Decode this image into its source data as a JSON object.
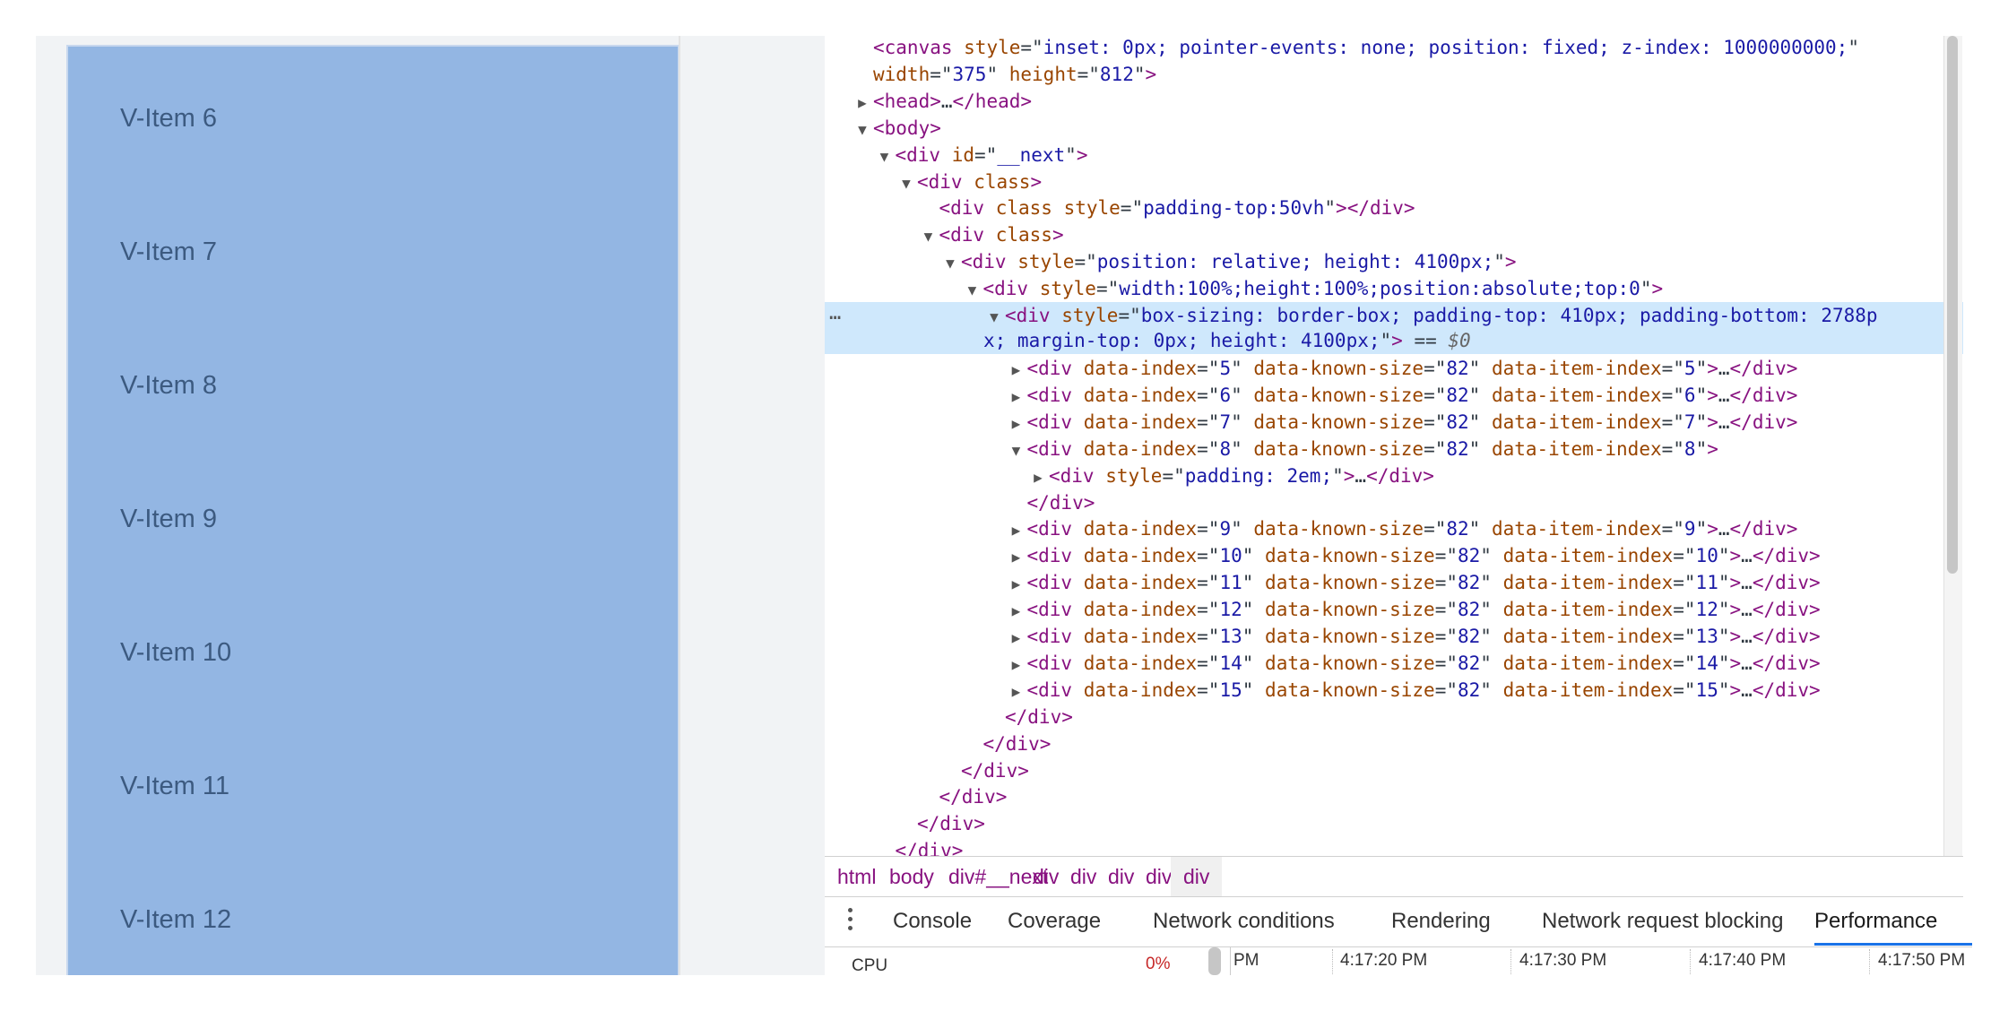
{
  "viewport": {
    "items": [
      "V-Item 6",
      "V-Item 7",
      "V-Item 8",
      "V-Item 9",
      "V-Item 10",
      "V-Item 11",
      "V-Item 12"
    ]
  },
  "elements": {
    "lines": [
      {
        "i": 0,
        "arrow": "",
        "parts": [
          [
            "tag",
            "<canvas "
          ],
          [
            "attr",
            "style"
          ],
          [
            "eq",
            "=\""
          ],
          [
            "val",
            "inset: 0px; pointer-events: none; position: fixed; z-index: 1000000000;"
          ],
          [
            "eq",
            "\""
          ]
        ]
      },
      {
        "i": 0,
        "arrow": "",
        "parts": [
          [
            "attr",
            "width"
          ],
          [
            "eq",
            "=\""
          ],
          [
            "val",
            "375"
          ],
          [
            "eq",
            "\" "
          ],
          [
            "attr",
            "height"
          ],
          [
            "eq",
            "=\""
          ],
          [
            "val",
            "812"
          ],
          [
            "eq",
            "\""
          ],
          [
            "tag",
            ">"
          ]
        ]
      },
      {
        "i": 0,
        "arrow": "▶",
        "parts": [
          [
            "tag",
            "<head>"
          ],
          [
            "txt",
            "…"
          ],
          [
            "tag",
            "</head>"
          ]
        ]
      },
      {
        "i": 0,
        "arrow": "▼",
        "parts": [
          [
            "tag",
            "<body>"
          ]
        ]
      },
      {
        "i": 1,
        "arrow": "▼",
        "parts": [
          [
            "tag",
            "<div "
          ],
          [
            "attr",
            "id"
          ],
          [
            "eq",
            "=\""
          ],
          [
            "val",
            "__next"
          ],
          [
            "eq",
            "\""
          ],
          [
            "tag",
            ">"
          ]
        ]
      },
      {
        "i": 2,
        "arrow": "▼",
        "parts": [
          [
            "tag",
            "<div "
          ],
          [
            "attr",
            "class"
          ],
          [
            "tag",
            ">"
          ]
        ]
      },
      {
        "i": 3,
        "arrow": "",
        "parts": [
          [
            "tag",
            "<div "
          ],
          [
            "attr",
            "class style"
          ],
          [
            "eq",
            "=\""
          ],
          [
            "val",
            "padding-top:50vh"
          ],
          [
            "eq",
            "\""
          ],
          [
            "tag",
            "></div>"
          ]
        ]
      },
      {
        "i": 3,
        "arrow": "▼",
        "parts": [
          [
            "tag",
            "<div "
          ],
          [
            "attr",
            "class"
          ],
          [
            "tag",
            ">"
          ]
        ]
      },
      {
        "i": 4,
        "arrow": "▼",
        "parts": [
          [
            "tag",
            "<div "
          ],
          [
            "attr",
            "style"
          ],
          [
            "eq",
            "=\""
          ],
          [
            "val",
            "position: relative; height: 4100px;"
          ],
          [
            "eq",
            "\""
          ],
          [
            "tag",
            ">"
          ]
        ]
      },
      {
        "i": 5,
        "arrow": "▼",
        "parts": [
          [
            "tag",
            "<div "
          ],
          [
            "attr",
            "style"
          ],
          [
            "eq",
            "=\""
          ],
          [
            "val",
            "width:100%;height:100%;position:absolute;top:0"
          ],
          [
            "eq",
            "\""
          ],
          [
            "tag",
            ">"
          ]
        ]
      },
      {
        "i": 6,
        "arrow": "▼",
        "selected": true,
        "parts": [
          [
            "tag",
            "<div "
          ],
          [
            "attr",
            "style"
          ],
          [
            "eq",
            "=\""
          ],
          [
            "val",
            "box-sizing: border-box; padding-top: 410px; padding-bottom: 2788p"
          ]
        ],
        "cont": [
          [
            "val",
            "x; margin-top: 0px; height: 4100px;"
          ],
          [
            "eq",
            "\""
          ],
          [
            "tag",
            ">"
          ],
          [
            "txt",
            " == "
          ],
          [
            "dollar",
            "$0"
          ]
        ]
      },
      {
        "i": 7,
        "arrow": "▶",
        "parts": [
          [
            "tag",
            "<div "
          ],
          [
            "attr",
            "data-index"
          ],
          [
            "eq",
            "=\""
          ],
          [
            "val",
            "5"
          ],
          [
            "eq",
            "\" "
          ],
          [
            "attr",
            "data-known-size"
          ],
          [
            "eq",
            "=\""
          ],
          [
            "val",
            "82"
          ],
          [
            "eq",
            "\" "
          ],
          [
            "attr",
            "data-item-index"
          ],
          [
            "eq",
            "=\""
          ],
          [
            "val",
            "5"
          ],
          [
            "eq",
            "\""
          ],
          [
            "tag",
            ">"
          ],
          [
            "txt",
            "…"
          ],
          [
            "tag",
            "</div>"
          ]
        ]
      },
      {
        "i": 7,
        "arrow": "▶",
        "parts": [
          [
            "tag",
            "<div "
          ],
          [
            "attr",
            "data-index"
          ],
          [
            "eq",
            "=\""
          ],
          [
            "val",
            "6"
          ],
          [
            "eq",
            "\" "
          ],
          [
            "attr",
            "data-known-size"
          ],
          [
            "eq",
            "=\""
          ],
          [
            "val",
            "82"
          ],
          [
            "eq",
            "\" "
          ],
          [
            "attr",
            "data-item-index"
          ],
          [
            "eq",
            "=\""
          ],
          [
            "val",
            "6"
          ],
          [
            "eq",
            "\""
          ],
          [
            "tag",
            ">"
          ],
          [
            "txt",
            "…"
          ],
          [
            "tag",
            "</div>"
          ]
        ]
      },
      {
        "i": 7,
        "arrow": "▶",
        "parts": [
          [
            "tag",
            "<div "
          ],
          [
            "attr",
            "data-index"
          ],
          [
            "eq",
            "=\""
          ],
          [
            "val",
            "7"
          ],
          [
            "eq",
            "\" "
          ],
          [
            "attr",
            "data-known-size"
          ],
          [
            "eq",
            "=\""
          ],
          [
            "val",
            "82"
          ],
          [
            "eq",
            "\" "
          ],
          [
            "attr",
            "data-item-index"
          ],
          [
            "eq",
            "=\""
          ],
          [
            "val",
            "7"
          ],
          [
            "eq",
            "\""
          ],
          [
            "tag",
            ">"
          ],
          [
            "txt",
            "…"
          ],
          [
            "tag",
            "</div>"
          ]
        ]
      },
      {
        "i": 7,
        "arrow": "▼",
        "parts": [
          [
            "tag",
            "<div "
          ],
          [
            "attr",
            "data-index"
          ],
          [
            "eq",
            "=\""
          ],
          [
            "val",
            "8"
          ],
          [
            "eq",
            "\" "
          ],
          [
            "attr",
            "data-known-size"
          ],
          [
            "eq",
            "=\""
          ],
          [
            "val",
            "82"
          ],
          [
            "eq",
            "\" "
          ],
          [
            "attr",
            "data-item-index"
          ],
          [
            "eq",
            "=\""
          ],
          [
            "val",
            "8"
          ],
          [
            "eq",
            "\""
          ],
          [
            "tag",
            ">"
          ]
        ]
      },
      {
        "i": 8,
        "arrow": "▶",
        "parts": [
          [
            "tag",
            "<div "
          ],
          [
            "attr",
            "style"
          ],
          [
            "eq",
            "=\""
          ],
          [
            "val",
            "padding: 2em;"
          ],
          [
            "eq",
            "\""
          ],
          [
            "tag",
            ">"
          ],
          [
            "txt",
            "…"
          ],
          [
            "tag",
            "</div>"
          ]
        ]
      },
      {
        "i": 7,
        "arrow": "",
        "parts": [
          [
            "tag",
            "</div>"
          ]
        ]
      },
      {
        "i": 7,
        "arrow": "▶",
        "parts": [
          [
            "tag",
            "<div "
          ],
          [
            "attr",
            "data-index"
          ],
          [
            "eq",
            "=\""
          ],
          [
            "val",
            "9"
          ],
          [
            "eq",
            "\" "
          ],
          [
            "attr",
            "data-known-size"
          ],
          [
            "eq",
            "=\""
          ],
          [
            "val",
            "82"
          ],
          [
            "eq",
            "\" "
          ],
          [
            "attr",
            "data-item-index"
          ],
          [
            "eq",
            "=\""
          ],
          [
            "val",
            "9"
          ],
          [
            "eq",
            "\""
          ],
          [
            "tag",
            ">"
          ],
          [
            "txt",
            "…"
          ],
          [
            "tag",
            "</div>"
          ]
        ]
      },
      {
        "i": 7,
        "arrow": "▶",
        "parts": [
          [
            "tag",
            "<div "
          ],
          [
            "attr",
            "data-index"
          ],
          [
            "eq",
            "=\""
          ],
          [
            "val",
            "10"
          ],
          [
            "eq",
            "\" "
          ],
          [
            "attr",
            "data-known-size"
          ],
          [
            "eq",
            "=\""
          ],
          [
            "val",
            "82"
          ],
          [
            "eq",
            "\" "
          ],
          [
            "attr",
            "data-item-index"
          ],
          [
            "eq",
            "=\""
          ],
          [
            "val",
            "10"
          ],
          [
            "eq",
            "\""
          ],
          [
            "tag",
            ">"
          ],
          [
            "txt",
            "…"
          ],
          [
            "tag",
            "</div>"
          ]
        ]
      },
      {
        "i": 7,
        "arrow": "▶",
        "parts": [
          [
            "tag",
            "<div "
          ],
          [
            "attr",
            "data-index"
          ],
          [
            "eq",
            "=\""
          ],
          [
            "val",
            "11"
          ],
          [
            "eq",
            "\" "
          ],
          [
            "attr",
            "data-known-size"
          ],
          [
            "eq",
            "=\""
          ],
          [
            "val",
            "82"
          ],
          [
            "eq",
            "\" "
          ],
          [
            "attr",
            "data-item-index"
          ],
          [
            "eq",
            "=\""
          ],
          [
            "val",
            "11"
          ],
          [
            "eq",
            "\""
          ],
          [
            "tag",
            ">"
          ],
          [
            "txt",
            "…"
          ],
          [
            "tag",
            "</div>"
          ]
        ]
      },
      {
        "i": 7,
        "arrow": "▶",
        "parts": [
          [
            "tag",
            "<div "
          ],
          [
            "attr",
            "data-index"
          ],
          [
            "eq",
            "=\""
          ],
          [
            "val",
            "12"
          ],
          [
            "eq",
            "\" "
          ],
          [
            "attr",
            "data-known-size"
          ],
          [
            "eq",
            "=\""
          ],
          [
            "val",
            "82"
          ],
          [
            "eq",
            "\" "
          ],
          [
            "attr",
            "data-item-index"
          ],
          [
            "eq",
            "=\""
          ],
          [
            "val",
            "12"
          ],
          [
            "eq",
            "\""
          ],
          [
            "tag",
            ">"
          ],
          [
            "txt",
            "…"
          ],
          [
            "tag",
            "</div>"
          ]
        ]
      },
      {
        "i": 7,
        "arrow": "▶",
        "parts": [
          [
            "tag",
            "<div "
          ],
          [
            "attr",
            "data-index"
          ],
          [
            "eq",
            "=\""
          ],
          [
            "val",
            "13"
          ],
          [
            "eq",
            "\" "
          ],
          [
            "attr",
            "data-known-size"
          ],
          [
            "eq",
            "=\""
          ],
          [
            "val",
            "82"
          ],
          [
            "eq",
            "\" "
          ],
          [
            "attr",
            "data-item-index"
          ],
          [
            "eq",
            "=\""
          ],
          [
            "val",
            "13"
          ],
          [
            "eq",
            "\""
          ],
          [
            "tag",
            ">"
          ],
          [
            "txt",
            "…"
          ],
          [
            "tag",
            "</div>"
          ]
        ]
      },
      {
        "i": 7,
        "arrow": "▶",
        "parts": [
          [
            "tag",
            "<div "
          ],
          [
            "attr",
            "data-index"
          ],
          [
            "eq",
            "=\""
          ],
          [
            "val",
            "14"
          ],
          [
            "eq",
            "\" "
          ],
          [
            "attr",
            "data-known-size"
          ],
          [
            "eq",
            "=\""
          ],
          [
            "val",
            "82"
          ],
          [
            "eq",
            "\" "
          ],
          [
            "attr",
            "data-item-index"
          ],
          [
            "eq",
            "=\""
          ],
          [
            "val",
            "14"
          ],
          [
            "eq",
            "\""
          ],
          [
            "tag",
            ">"
          ],
          [
            "txt",
            "…"
          ],
          [
            "tag",
            "</div>"
          ]
        ]
      },
      {
        "i": 7,
        "arrow": "▶",
        "parts": [
          [
            "tag",
            "<div "
          ],
          [
            "attr",
            "data-index"
          ],
          [
            "eq",
            "=\""
          ],
          [
            "val",
            "15"
          ],
          [
            "eq",
            "\" "
          ],
          [
            "attr",
            "data-known-size"
          ],
          [
            "eq",
            "=\""
          ],
          [
            "val",
            "82"
          ],
          [
            "eq",
            "\" "
          ],
          [
            "attr",
            "data-item-index"
          ],
          [
            "eq",
            "=\""
          ],
          [
            "val",
            "15"
          ],
          [
            "eq",
            "\""
          ],
          [
            "tag",
            ">"
          ],
          [
            "txt",
            "…"
          ],
          [
            "tag",
            "</div>"
          ]
        ]
      },
      {
        "i": 6,
        "arrow": "",
        "parts": [
          [
            "tag",
            "</div>"
          ]
        ]
      },
      {
        "i": 5,
        "arrow": "",
        "parts": [
          [
            "tag",
            "</div>"
          ]
        ]
      },
      {
        "i": 4,
        "arrow": "",
        "parts": [
          [
            "tag",
            "</div>"
          ]
        ]
      },
      {
        "i": 3,
        "arrow": "",
        "parts": [
          [
            "tag",
            "</div>"
          ]
        ]
      },
      {
        "i": 2,
        "arrow": "",
        "parts": [
          [
            "tag",
            "</div>"
          ]
        ]
      },
      {
        "i": 1,
        "arrow": "",
        "parts": [
          [
            "tag",
            "</div>"
          ]
        ]
      }
    ]
  },
  "breadcrumb": [
    "html",
    "body",
    "div#__next",
    "div",
    "div",
    "div",
    "div",
    "div"
  ],
  "drawer": {
    "tabs": [
      "Console",
      "Coverage",
      "Network conditions",
      "Rendering",
      "Network request blocking",
      "Performance"
    ],
    "active": "Performance"
  },
  "performance": {
    "label": "CPU",
    "percent": "0%",
    "times": [
      "PM",
      "4:17:20 PM",
      "4:17:30 PM",
      "4:17:40 PM",
      "4:17:50 PM"
    ]
  },
  "colors": {
    "list_bg": "#93b6e3",
    "item_text": "#3c5a80",
    "selected_row": "#cfe8fc",
    "tag": "#881280",
    "attr": "#994500",
    "value": "#1a1aa6",
    "active_tab_underline": "#1a73e8"
  },
  "icons": [
    "more-options-icon",
    "expand-arrow-icon",
    "collapse-arrow-icon",
    "kebab-menu-icon"
  ]
}
